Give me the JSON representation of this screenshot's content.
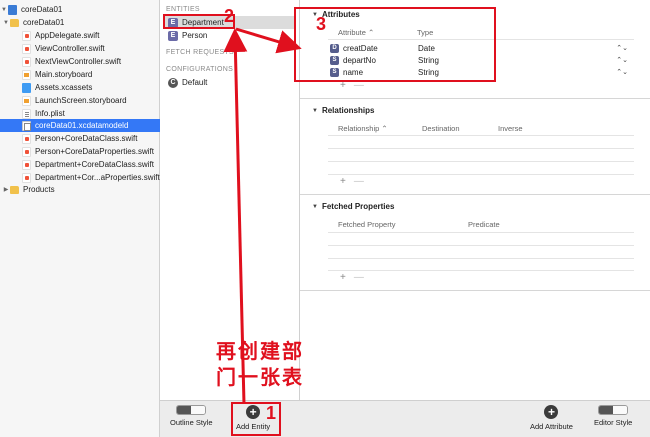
{
  "navigator": {
    "items": [
      {
        "label": "coreData01",
        "icon": "project-icon",
        "expanded": true
      },
      {
        "label": "coreData01",
        "icon": "folder-icon",
        "expanded": true
      },
      {
        "label": "AppDelegate.swift",
        "icon": "swift-file-icon"
      },
      {
        "label": "ViewController.swift",
        "icon": "swift-file-icon"
      },
      {
        "label": "NextViewController.swift",
        "icon": "swift-file-icon"
      },
      {
        "label": "Main.storyboard",
        "icon": "storyboard-icon"
      },
      {
        "label": "Assets.xcassets",
        "icon": "assets-icon"
      },
      {
        "label": "LaunchScreen.storyboard",
        "icon": "storyboard-icon"
      },
      {
        "label": "Info.plist",
        "icon": "plist-icon"
      },
      {
        "label": "coreData01.xcdatamodeld",
        "icon": "data-model-icon",
        "selected": true
      },
      {
        "label": "Person+CoreDataClass.swift",
        "icon": "swift-file-icon"
      },
      {
        "label": "Person+CoreDataProperties.swift",
        "icon": "swift-file-icon"
      },
      {
        "label": "Department+CoreDataClass.swift",
        "icon": "swift-file-icon"
      },
      {
        "label": "Department+Cor...aProperties.swift",
        "icon": "swift-file-icon"
      },
      {
        "label": "Products",
        "icon": "folder-icon",
        "expanded": false
      }
    ]
  },
  "entities_pane": {
    "entities_header": "ENTITIES",
    "entities": [
      {
        "badge": "E",
        "label": "Department",
        "selected": true
      },
      {
        "badge": "E",
        "label": "Person"
      }
    ],
    "fetch_requests_header": "FETCH REQUESTS",
    "configurations_header": "CONFIGURATIONS",
    "configurations": [
      {
        "badge": "C",
        "label": "Default"
      }
    ]
  },
  "attributes": {
    "title": "Attributes",
    "col_attribute": "Attribute",
    "col_type": "Type",
    "rows": [
      {
        "badge": "D",
        "name": "creatDate",
        "type": "Date"
      },
      {
        "badge": "S",
        "name": "departNo",
        "type": "String"
      },
      {
        "badge": "S",
        "name": "name",
        "type": "String"
      }
    ]
  },
  "relationships": {
    "title": "Relationships",
    "col_relationship": "Relationship",
    "col_destination": "Destination",
    "col_inverse": "Inverse"
  },
  "fetched_properties": {
    "title": "Fetched Properties",
    "col_fetched_property": "Fetched Property",
    "col_predicate": "Predicate"
  },
  "controls": {
    "plus": "+",
    "minus": "—",
    "sort_indicator": "⌃",
    "stepper": "⌃⌄"
  },
  "bottom_bar": {
    "outline_style": "Outline Style",
    "add_entity": "Add Entity",
    "add_attribute": "Add Attribute",
    "editor_style": "Editor Style"
  },
  "annotations": {
    "num1": "1",
    "num2": "2",
    "num3": "3",
    "caption_line1": "再创建部",
    "caption_line2": "门一张表"
  },
  "colors": {
    "selection": "#3478f6",
    "annotation": "#e0101e"
  }
}
